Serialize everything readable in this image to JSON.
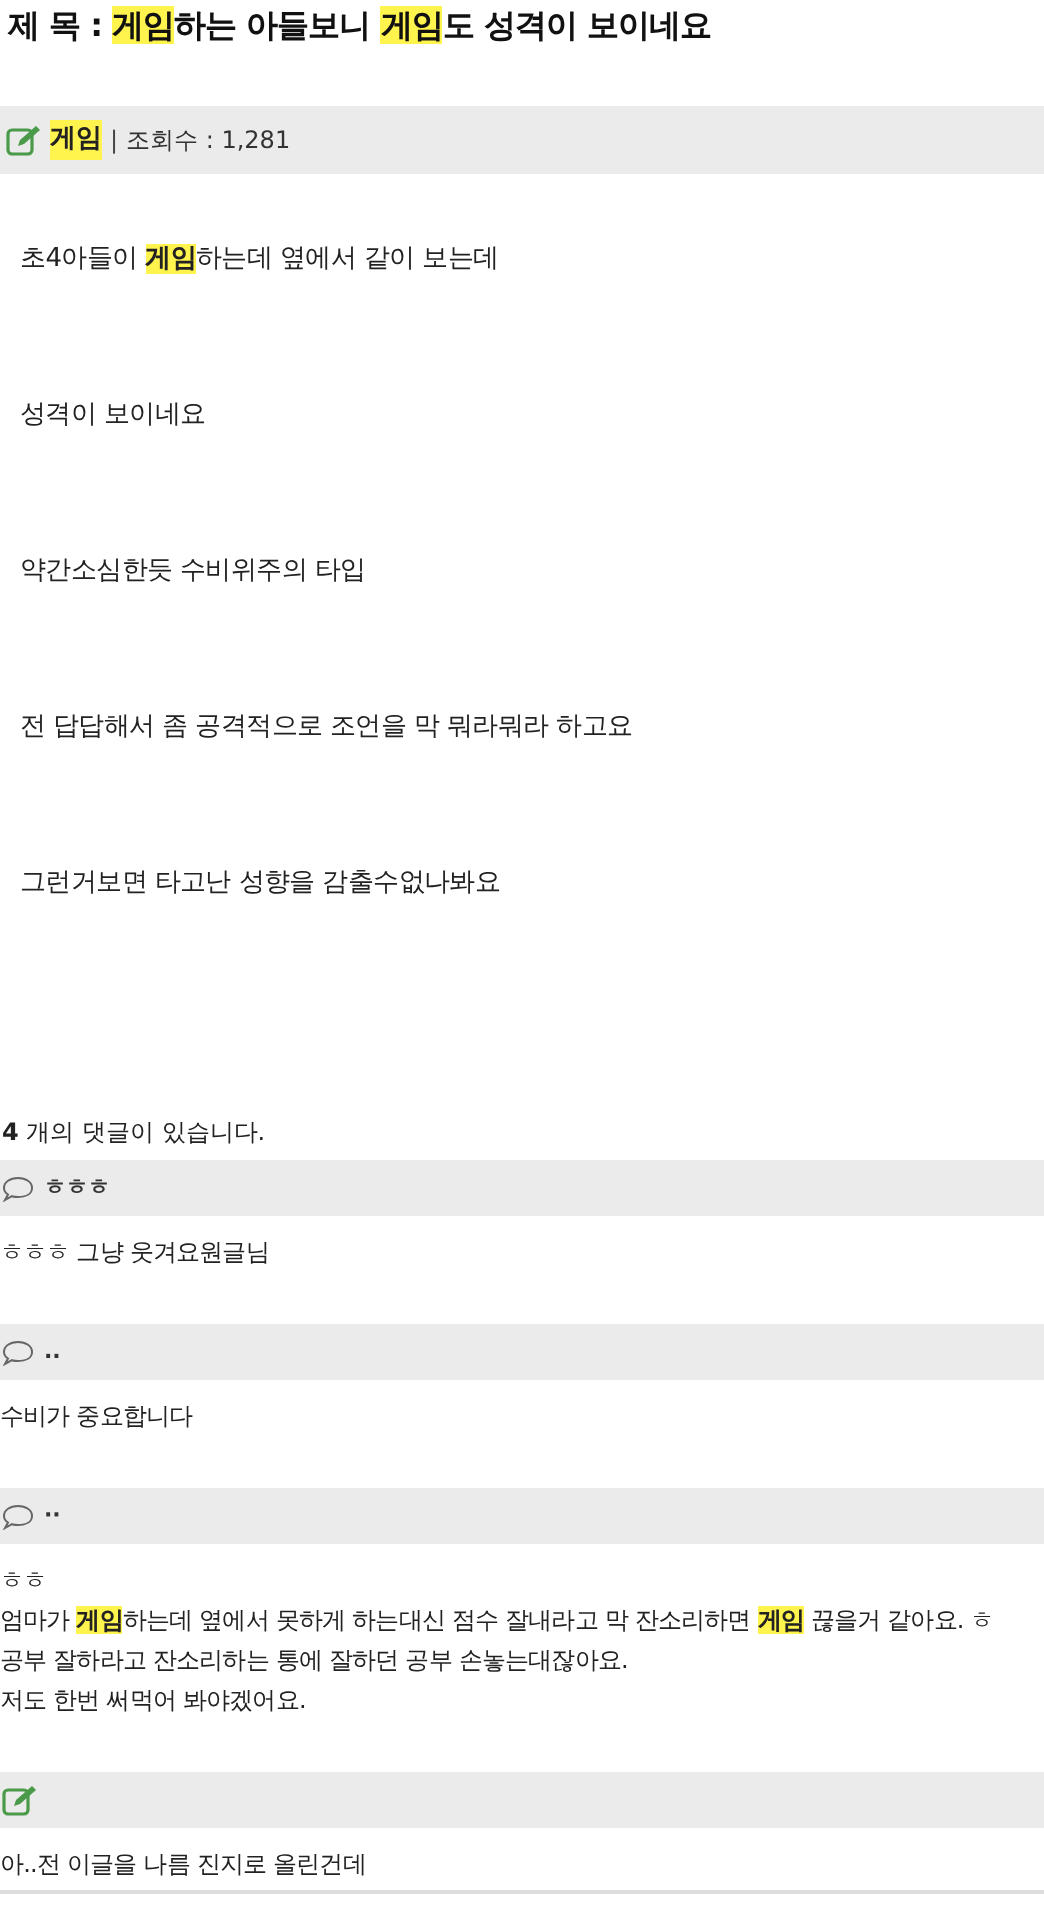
{
  "title": {
    "label": "제 목 : ",
    "segments": [
      {
        "text": "게임",
        "highlighted": true
      },
      {
        "text": "하는 아들보니 ",
        "highlighted": false
      },
      {
        "text": "게임",
        "highlighted": true
      },
      {
        "text": "도 성격이 보이네요",
        "highlighted": false
      }
    ]
  },
  "meta": {
    "category": {
      "text": "게임",
      "highlighted": true
    },
    "separator": "|",
    "views": "조회수 : 1,281"
  },
  "body": [
    [
      {
        "text": "초4아들이 ",
        "highlighted": false
      },
      {
        "text": "게임",
        "highlighted": true
      },
      {
        "text": "하는데 옆에서 같이 보는데",
        "highlighted": false
      }
    ],
    [
      {
        "text": "성격이 보이네요",
        "highlighted": false
      }
    ],
    [
      {
        "text": "약간소심한듯 수비위주의 타입",
        "highlighted": false
      }
    ],
    [
      {
        "text": "전 답답해서 좀 공격적으로 조언을 막 뭐라뭐라 하고요",
        "highlighted": false
      }
    ],
    [
      {
        "text": "그런거보면 타고난 성향을 감출수없나봐요",
        "highlighted": false
      }
    ]
  ],
  "comment_count": "**4** 개의 댓글이 있습니다.",
  "comments": [
    {
      "kind": "speech",
      "author": "ㅎㅎㅎ",
      "lines": [
        [
          {
            "text": "ㅎㅎㅎ 그냥 웃겨요원글님",
            "highlighted": false
          }
        ]
      ]
    },
    {
      "kind": "speech",
      "author": "..",
      "lines": [
        [
          {
            "text": "수비가 중요합니다",
            "highlighted": false
          }
        ]
      ]
    },
    {
      "kind": "speech",
      "author": "··",
      "lines": [
        [
          {
            "text": "ㅎㅎ",
            "highlighted": false
          }
        ],
        [
          {
            "text": "엄마가 ",
            "highlighted": false
          },
          {
            "text": "게임",
            "highlighted": true
          },
          {
            "text": "하는데 옆에서 못하게 하는대신 점수 잘내라고 막 잔소리하면 ",
            "highlighted": false
          },
          {
            "text": "게임",
            "highlighted": true
          },
          {
            "text": " 끊을거 같아요. ㅎ",
            "highlighted": false
          }
        ],
        [
          {
            "text": "공부 잘하라고 잔소리하는 통에 잘하던 공부 손놓는대잖아요.",
            "highlighted": false
          }
        ],
        [
          {
            "text": "저도 한번 써먹어 봐야겠어요.",
            "highlighted": false
          }
        ]
      ]
    },
    {
      "kind": "edit",
      "lines": [
        [
          {
            "text": "아..전 이글을 나름 진지로 올린건데",
            "highlighted": false
          }
        ]
      ]
    }
  ]
}
